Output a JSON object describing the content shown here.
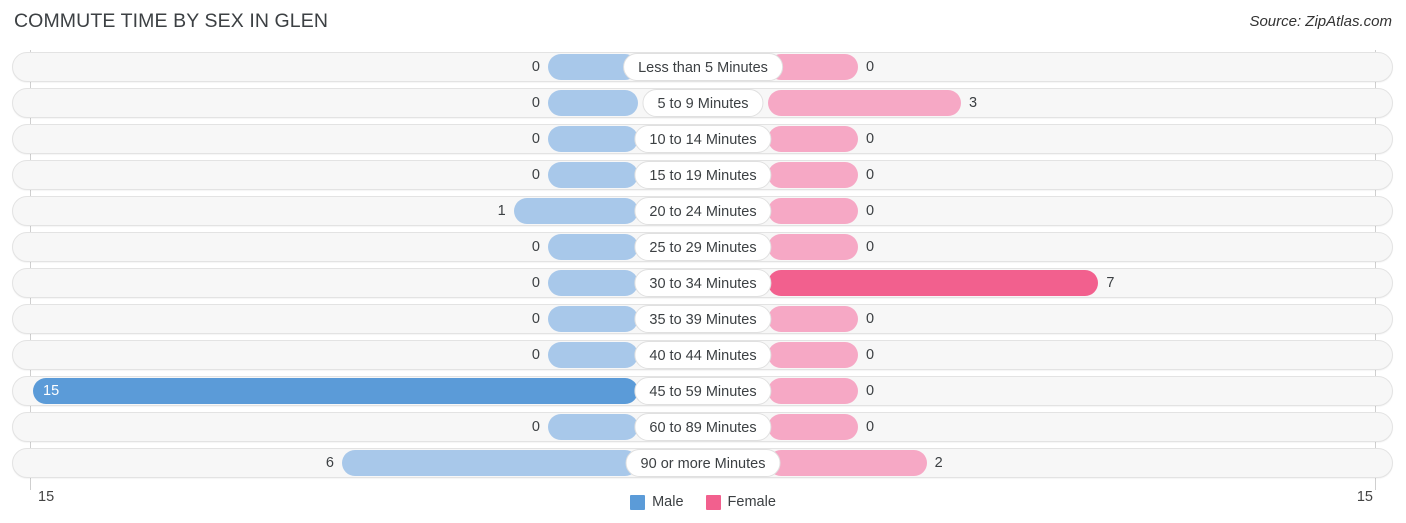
{
  "header": {
    "title": "COMMUTE TIME BY SEX IN GLEN",
    "source": "Source: ZipAtlas.com"
  },
  "legend": {
    "male_label": "Male",
    "female_label": "Female",
    "male_color": "#5b9bd8",
    "female_color": "#f2608e"
  },
  "axis": {
    "left_end_label": "15",
    "right_end_label": "15",
    "max": 15
  },
  "colors": {
    "male_light": "#a8c8ea",
    "male_strong": "#5b9bd8",
    "female_light": "#f6a8c5",
    "female_strong": "#f2608e",
    "track": "#f7f7f7",
    "track_border": "#e3e3e3"
  },
  "chart_data": {
    "type": "bar",
    "title": "COMMUTE TIME BY SEX IN GLEN",
    "subtitle": "Source: ZipAtlas.com",
    "orientation": "horizontal-diverging",
    "xlabel": "",
    "ylabel": "",
    "xlim": [
      15,
      15
    ],
    "grid": false,
    "legend_position": "bottom-center",
    "categories": [
      "Less than 5 Minutes",
      "5 to 9 Minutes",
      "10 to 14 Minutes",
      "15 to 19 Minutes",
      "20 to 24 Minutes",
      "25 to 29 Minutes",
      "30 to 34 Minutes",
      "35 to 39 Minutes",
      "40 to 44 Minutes",
      "45 to 59 Minutes",
      "60 to 89 Minutes",
      "90 or more Minutes"
    ],
    "series": [
      {
        "name": "Male",
        "color": "#5b9bd8",
        "values": [
          0,
          0,
          0,
          0,
          1,
          0,
          0,
          0,
          0,
          15,
          0,
          6
        ]
      },
      {
        "name": "Female",
        "color": "#f2608e",
        "values": [
          0,
          3,
          0,
          0,
          0,
          0,
          7,
          0,
          0,
          0,
          0,
          2
        ]
      }
    ]
  },
  "rows": [
    {
      "label": "Less than 5 Minutes",
      "male": "0",
      "female": "0"
    },
    {
      "label": "5 to 9 Minutes",
      "male": "0",
      "female": "3"
    },
    {
      "label": "10 to 14 Minutes",
      "male": "0",
      "female": "0"
    },
    {
      "label": "15 to 19 Minutes",
      "male": "0",
      "female": "0"
    },
    {
      "label": "20 to 24 Minutes",
      "male": "1",
      "female": "0"
    },
    {
      "label": "25 to 29 Minutes",
      "male": "0",
      "female": "0"
    },
    {
      "label": "30 to 34 Minutes",
      "male": "0",
      "female": "7"
    },
    {
      "label": "35 to 39 Minutes",
      "male": "0",
      "female": "0"
    },
    {
      "label": "40 to 44 Minutes",
      "male": "0",
      "female": "0"
    },
    {
      "label": "45 to 59 Minutes",
      "male": "15",
      "female": "0"
    },
    {
      "label": "60 to 89 Minutes",
      "male": "0",
      "female": "0"
    },
    {
      "label": "90 or more Minutes",
      "male": "6",
      "female": "2"
    }
  ]
}
